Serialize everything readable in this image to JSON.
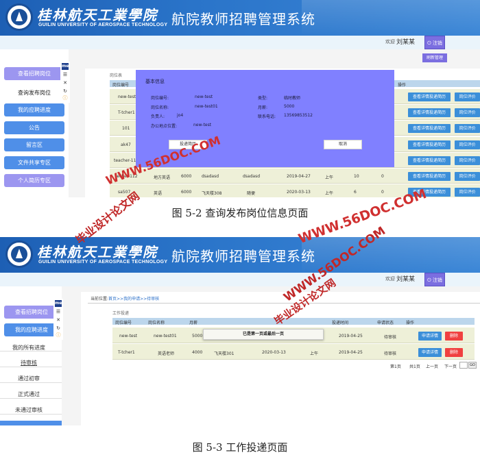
{
  "header": {
    "university_cn": "桂林航天工業學院",
    "university_en": "GUILIN UNIVERSITY OF AEROSPACE TECHNOLOGY",
    "system_title": "航院教师招聘管理系统",
    "welcome": "欢迎",
    "username": "刘某某",
    "logout_label": "注销"
  },
  "figure1": {
    "caption": "图 5-2 查询发布岗位信息页面",
    "sidebar": [
      "查看招聘岗位",
      "查询发布岗位",
      "我的应聘进度",
      "公告",
      "留言区",
      "文件共享专区",
      "个人简历专区"
    ],
    "top_button": "刷新管理",
    "section_label": "岗位表",
    "columns": {
      "id": "岗位编号",
      "ops": "操作"
    },
    "rows": [
      {
        "id": "new-test"
      },
      {
        "id": "T-tcher1"
      },
      {
        "id": "101"
      },
      {
        "id": "ak47"
      },
      {
        "id": "teacher-11"
      },
      {
        "id": "techer-112",
        "c2": "地方英语",
        "c3": "6000",
        "c4": "dsadasd",
        "c5": "dsadasd",
        "date": "2019-04-27",
        "slot": "上午",
        "n1": "10",
        "n2": "0"
      },
      {
        "id": "sa507",
        "c2": "英语",
        "c3": "6000",
        "c4": "飞天楼308",
        "c5": "随便",
        "date": "2020-03-13",
        "slot": "上午",
        "n1": "6",
        "n2": "0"
      }
    ],
    "row_buttons": {
      "view": "查看详情投递简历",
      "rate": "岗位评价"
    },
    "modal": {
      "title": "基本信息",
      "id_label": "岗位编号:",
      "id_value": "new-test",
      "name_label": "岗位名称:",
      "name_value": "new-test01",
      "owner_label": "负责人:",
      "owner_value": "jo4",
      "office_label": "办公地点位置:",
      "office_value": "new-test",
      "type_label": "类型:",
      "type_value": "临时教师",
      "salary_label": "月薪:",
      "salary_value": "5000",
      "phone_label": "联系电话:",
      "phone_value": "13569853512",
      "submit_label": "投递简历",
      "cancel_label": "取消"
    }
  },
  "figure2": {
    "caption": "图 5-3 工作投递页面",
    "breadcrumb": {
      "prefix": "当前位置:",
      "path": "首页>>我的申请>>待审核"
    },
    "section_label": "工作投递",
    "sidebar": [
      "查看招聘岗位",
      "我的应聘进度",
      "我的所有进度",
      "待审核",
      "通过初审",
      "正式通过",
      "未通过审核"
    ],
    "columns": [
      "岗位编号",
      "岗位名称",
      "月薪",
      "",
      "",
      "投递时间",
      "申请状态",
      "操作"
    ],
    "rows": [
      {
        "id": "new-test",
        "name": "new-test01",
        "salary": "5000",
        "loc": "",
        "date": "",
        "slot": "",
        "submitted": "2019-04-25",
        "status": "待审核"
      },
      {
        "id": "T-tcher1",
        "name": "英语老师",
        "salary": "4000",
        "loc": "飞天楼301",
        "date": "2020-03-13",
        "slot": "上午",
        "submitted": "2019-04-25",
        "status": "待审核"
      }
    ],
    "row_buttons": {
      "detail": "申请详情",
      "delete": "删除"
    },
    "tooltip": "已是第一页或最后一页",
    "pager": {
      "current": "第1页",
      "total": "共1页",
      "prev": "上一页",
      "next": "下一页",
      "go": "GO"
    }
  },
  "watermarks": [
    "WWW.56DOC.COM",
    "毕业设计论文网"
  ],
  "colors": {
    "banner": "#2a74c9",
    "modal": "#8080ff",
    "nav": "#4f8fe8",
    "nav_light": "#9c96f0",
    "row_button": "#3b8fd9",
    "delete": "#f04040"
  }
}
